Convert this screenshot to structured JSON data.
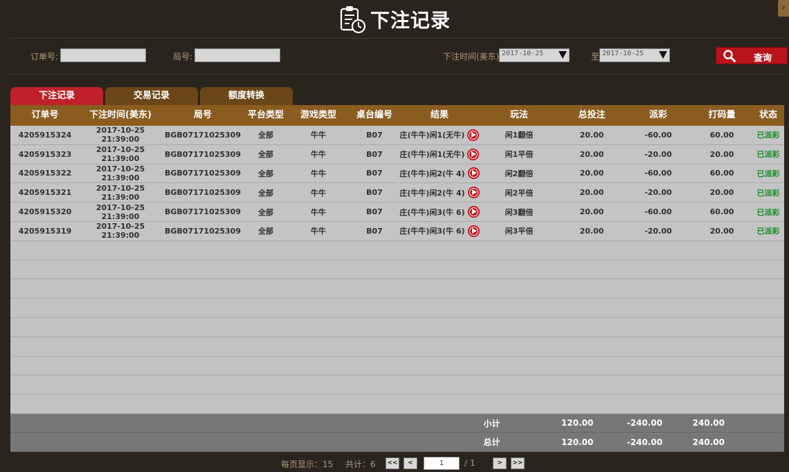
{
  "header": {
    "title": "下注记录"
  },
  "filters": {
    "order_label": "订单号:",
    "round_label": "局号:",
    "bet_time_label": "下注时间(美东):",
    "date_from": "2017-10-25",
    "to_label": "至",
    "date_to": "2017-10-25",
    "search_label": "查询"
  },
  "tabs": [
    {
      "label": "下注记录"
    },
    {
      "label": "交易记录"
    },
    {
      "label": "额度转换"
    }
  ],
  "table": {
    "columns": [
      "订单号",
      "下注时间(美东)",
      "局号",
      "平台类型",
      "游戏类型",
      "桌台编号",
      "结果",
      "玩法",
      "总投注",
      "派彩",
      "打码量",
      "状态"
    ],
    "rows": [
      [
        "4205915324",
        "2017-10-25 21:39:00",
        "BGB07171025309",
        "全部",
        "牛牛",
        "B07",
        "庄(牛牛)闲1(无牛)",
        "闲1翻倍",
        "20.00",
        "-60.00",
        "60.00",
        "已派彩"
      ],
      [
        "4205915323",
        "2017-10-25 21:39:00",
        "BGB07171025309",
        "全部",
        "牛牛",
        "B07",
        "庄(牛牛)闲1(无牛)",
        "闲1平倍",
        "20.00",
        "-20.00",
        "20.00",
        "已派彩"
      ],
      [
        "4205915322",
        "2017-10-25 21:39:00",
        "BGB07171025309",
        "全部",
        "牛牛",
        "B07",
        "庄(牛牛)闲2(牛 4)",
        "闲2翻倍",
        "20.00",
        "-60.00",
        "60.00",
        "已派彩"
      ],
      [
        "4205915321",
        "2017-10-25 21:39:00",
        "BGB07171025309",
        "全部",
        "牛牛",
        "B07",
        "庄(牛牛)闲2(牛 4)",
        "闲2平倍",
        "20.00",
        "-20.00",
        "20.00",
        "已派彩"
      ],
      [
        "4205915320",
        "2017-10-25 21:39:00",
        "BGB07171025309",
        "全部",
        "牛牛",
        "B07",
        "庄(牛牛)闲3(牛 6)",
        "闲3翻倍",
        "20.00",
        "-60.00",
        "60.00",
        "已派彩"
      ],
      [
        "4205915319",
        "2017-10-25 21:39:00",
        "BGB07171025309",
        "全部",
        "牛牛",
        "B07",
        "庄(牛牛)闲3(牛 6)",
        "闲3平倍",
        "20.00",
        "-20.00",
        "20.00",
        "已派彩"
      ]
    ],
    "subtotal": {
      "label": "小计",
      "bet": "120.00",
      "payout": "-240.00",
      "rolling": "240.00"
    },
    "total": {
      "label": "总计",
      "bet": "120.00",
      "payout": "-240.00",
      "rolling": "240.00"
    }
  },
  "pager": {
    "per_page": "每页显示：15",
    "count": "共计：6",
    "first": "<<",
    "prev": "<",
    "page_value": "1",
    "total_pages": "/ 1",
    "next": ">",
    "last": ">>"
  }
}
